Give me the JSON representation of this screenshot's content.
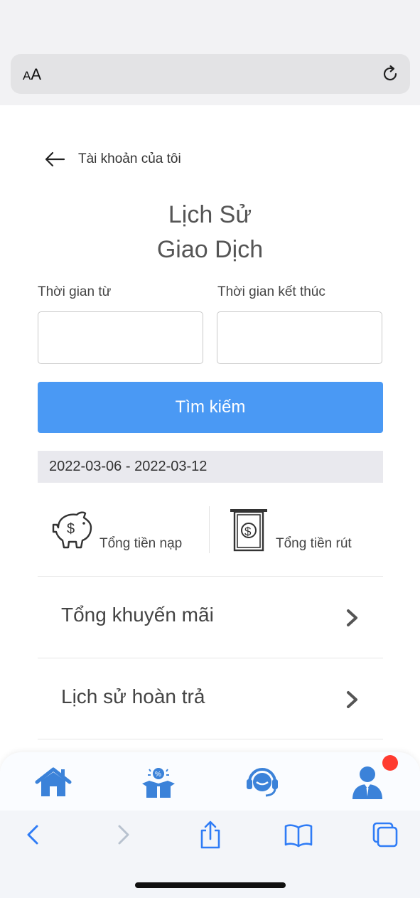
{
  "browser": {
    "text_size_button": "AA"
  },
  "header": {
    "back_label": "Tài khoản của tôi",
    "title_line1": "Lịch Sử",
    "title_line2": "Giao Dịch"
  },
  "filters": {
    "from_label": "Thời gian từ",
    "to_label": "Thời gian kết thúc",
    "from_value": "",
    "to_value": "",
    "search_label": "Tìm kiếm",
    "date_range": "2022-03-06 - 2022-03-12"
  },
  "summary": {
    "deposit_label": "Tổng tiền nạp",
    "withdraw_label": "Tổng tiền rút"
  },
  "menu": {
    "items": [
      {
        "label": "Tổng khuyến mãi",
        "icon": "chevron-right-icon"
      },
      {
        "label": "Lịch sử hoàn trả",
        "icon": "chevron-right-icon"
      }
    ]
  },
  "tabbar": {
    "items": [
      {
        "icon": "home-icon"
      },
      {
        "icon": "promotion-box-icon"
      },
      {
        "icon": "support-headset-icon"
      },
      {
        "icon": "profile-icon",
        "has_notification": true
      }
    ]
  },
  "colors": {
    "accent": "#4a99f4",
    "tab_icon": "#3b82d9",
    "notification": "#ff3b30",
    "range_bg": "#e9e9ee"
  }
}
